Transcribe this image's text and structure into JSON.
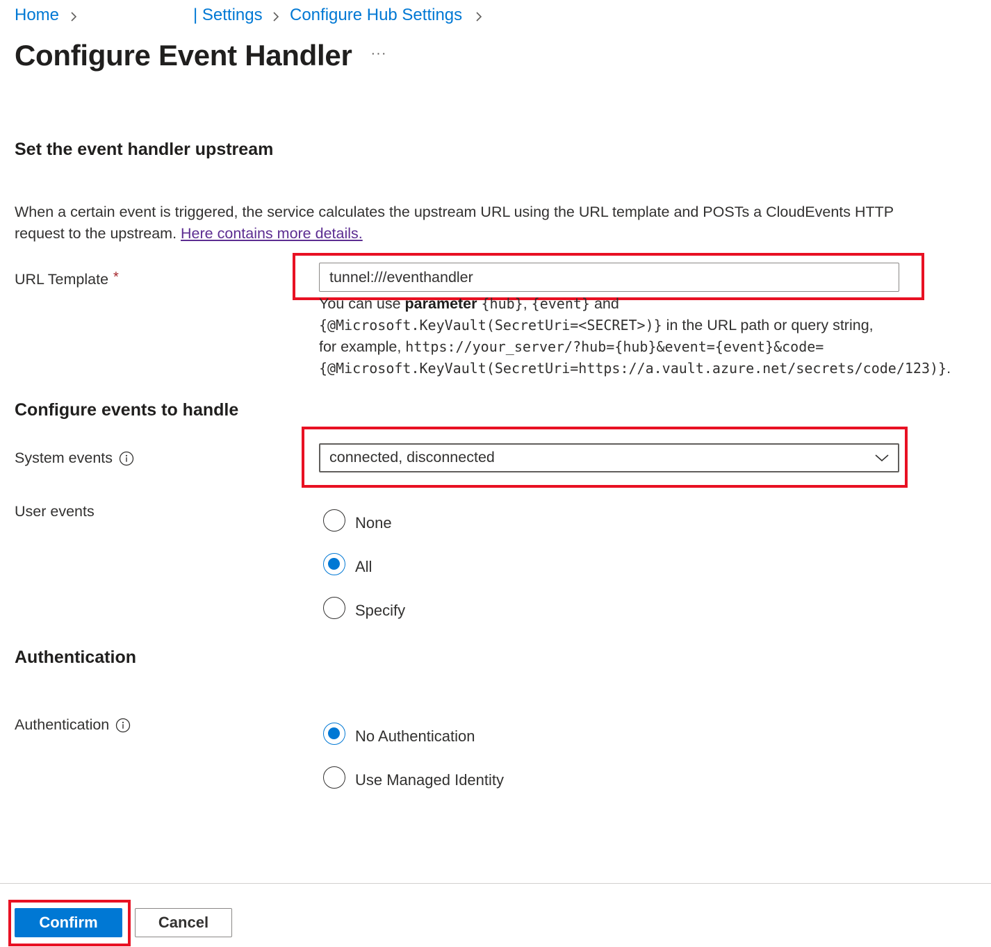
{
  "breadcrumb": {
    "items": [
      {
        "label": "Home"
      },
      {
        "label": "| Settings"
      },
      {
        "label": "Configure Hub Settings"
      }
    ]
  },
  "header": {
    "title": "Configure Event Handler",
    "more_label": "···"
  },
  "section_upstream": {
    "title": "Set the event handler upstream",
    "description": "When a certain event is triggered, the service calculates the upstream URL using the URL template and POSTs a CloudEvents HTTP request to the upstream. ",
    "link_text": "Here contains more details."
  },
  "url_template": {
    "label": "URL Template",
    "required_mark": "*",
    "value": "tunnel:///eventhandler",
    "help": {
      "prefix": "You can use ",
      "bold": "parameter",
      "param_hub": "{hub}",
      "comma": ", ",
      "param_event": "{event}",
      "and": " and",
      "keyvault_template": "{@Microsoft.KeyVault(SecretUri=<SECRET>)}",
      "path_text": " in the URL path or query string,",
      "example_prefix": "for example, ",
      "example_url": "https://your_server/?hub={hub}&event={event}&code=",
      "example_keyvault": "{@Microsoft.KeyVault(SecretUri=https://a.vault.azure.net/secrets/code/123)}",
      "example_end": "."
    }
  },
  "section_events": {
    "title": "Configure events to handle",
    "system_events": {
      "label": "System events",
      "value": "connected, disconnected"
    },
    "user_events": {
      "label": "User events",
      "options": [
        {
          "label": "None",
          "checked": false
        },
        {
          "label": "All",
          "checked": true
        },
        {
          "label": "Specify",
          "checked": false
        }
      ]
    }
  },
  "section_auth": {
    "title": "Authentication",
    "label": "Authentication",
    "options": [
      {
        "label": "No Authentication",
        "checked": true
      },
      {
        "label": "Use Managed Identity",
        "checked": false
      }
    ]
  },
  "footer": {
    "confirm_label": "Confirm",
    "cancel_label": "Cancel"
  },
  "colors": {
    "accent": "#0078d4",
    "highlight": "#e81123",
    "visited_link": "#5c2d91"
  }
}
